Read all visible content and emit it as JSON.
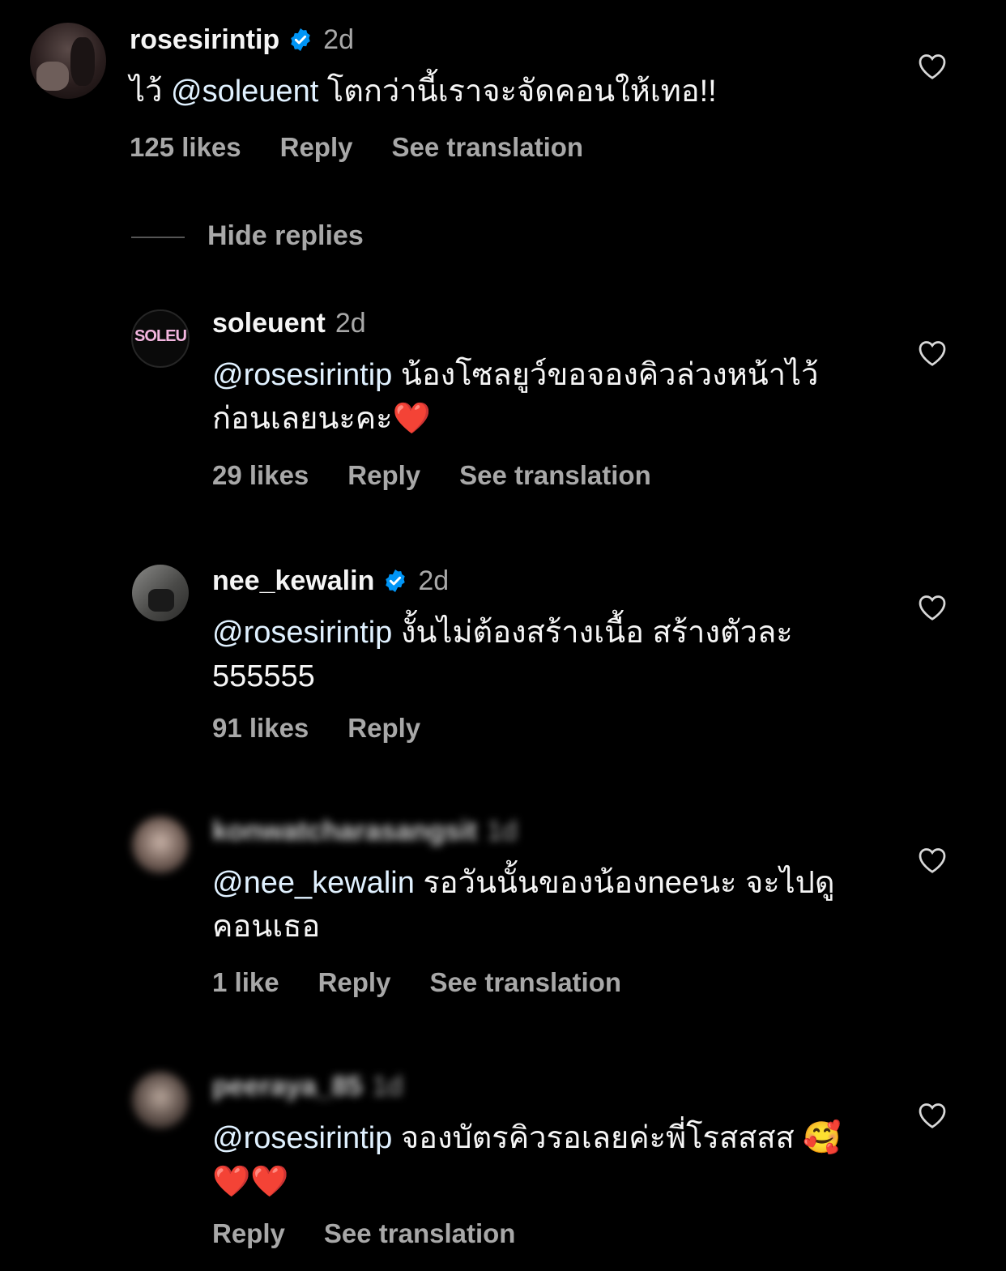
{
  "comments": [
    {
      "username": "rosesirintip",
      "verified": true,
      "time": "2d",
      "mention": "@soleuent",
      "text_prefix": "ไว้ ",
      "text": " โตกว่านี้เราจะจัดคอนให้เทอ!!",
      "likes": "125 likes",
      "reply": "Reply",
      "see_translation": "See translation",
      "avatar_icon": "profile-photo"
    },
    {
      "username": "soleuent",
      "verified": false,
      "time": "2d",
      "mention": "@rosesirintip",
      "text": " น้องโซลยูว์ขอจองคิวล่วงหน้าไว้ก่อนเลยนะคะ❤️",
      "likes": "29 likes",
      "reply": "Reply",
      "see_translation": "See translation",
      "avatar_logo": "SOLEU"
    },
    {
      "username": "nee_kewalin",
      "verified": true,
      "time": "2d",
      "mention": "@rosesirintip",
      "text": " งั้นไม่ต้องสร้างเนื้อ สร้างตัวละ 555555",
      "likes": "91 likes",
      "reply": "Reply"
    },
    {
      "username": "konwatcharasangsit",
      "verified": false,
      "time": "1d",
      "mention": "@nee_kewalin",
      "text": " รอวันนั้นของน้องneeนะ จะไปดูคอนเธอ",
      "likes": "1 like",
      "reply": "Reply",
      "see_translation": "See translation"
    },
    {
      "username": "peeraya_85",
      "verified": false,
      "time": "1d",
      "mention": "@rosesirintip",
      "text": " จองบัตรคิวรอเลยค่ะพี่โรสสสส 🥰❤️❤️",
      "reply": "Reply",
      "see_translation": "See translation"
    }
  ],
  "hide_replies": "Hide replies",
  "colors": {
    "background": "#000000",
    "text": "#f5f5f5",
    "muted": "#a8a8a8",
    "verified": "#0095f6"
  },
  "icons": [
    "heart-outline-icon",
    "verified-badge-icon"
  ]
}
